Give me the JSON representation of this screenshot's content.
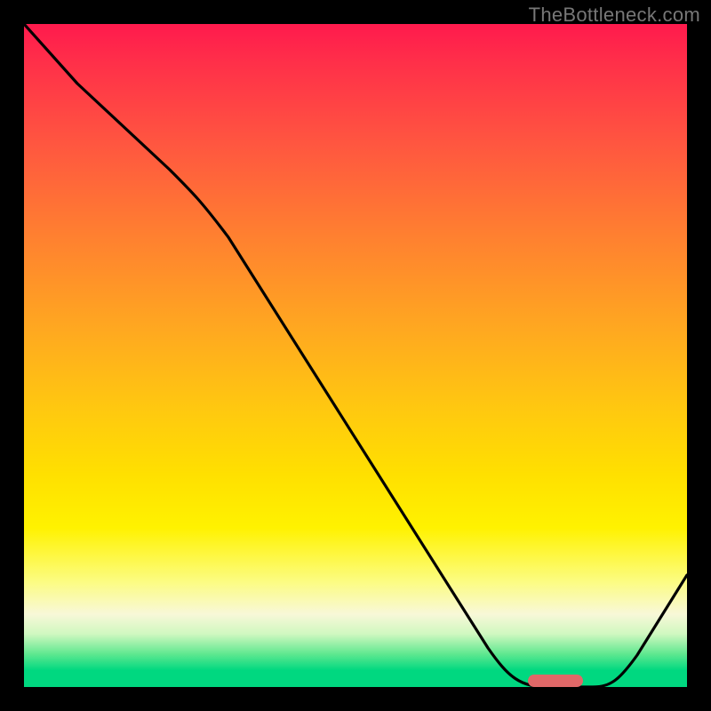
{
  "watermark": "TheBottleneck.com",
  "colors": {
    "marker": "#e06868",
    "curve_stroke": "#000000"
  },
  "chart_data": {
    "type": "line",
    "title": "",
    "xlabel": "",
    "ylabel": "",
    "xlim": [
      0,
      100
    ],
    "ylim": [
      0,
      100
    ],
    "grid": false,
    "legend": false,
    "note": "Axes unlabeled; values estimated from plot position (0 at bottom/left, 100 at top/right).",
    "series": [
      {
        "name": "bottleneck-curve",
        "x": [
          0,
          8,
          22,
          35,
          48,
          60,
          70,
          76,
          80,
          84,
          88,
          92,
          96,
          100
        ],
        "y": [
          100,
          91,
          78,
          61,
          44,
          28,
          14,
          5,
          1,
          0,
          1,
          5,
          12,
          20
        ]
      }
    ],
    "annotations": [
      {
        "name": "optimal-marker",
        "shape": "rounded-bar",
        "x_center": 80,
        "y_center": 0.8,
        "width_pct": 8,
        "color_key": "marker"
      }
    ]
  }
}
